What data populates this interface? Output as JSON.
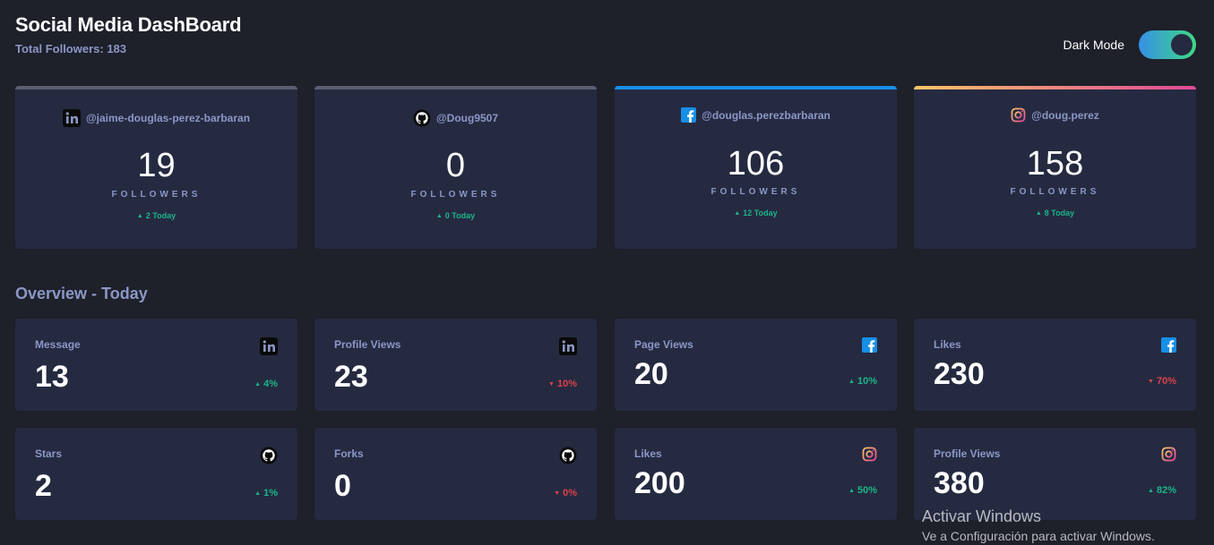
{
  "header": {
    "title": "Social Media DashBoard",
    "total_followers": "Total Followers: 183"
  },
  "toggle": {
    "label": "Dark Mode",
    "state": "on"
  },
  "colors": {
    "background": "#1e202a",
    "card": "#252a41",
    "muted_text": "#8b97c6",
    "up": "#1db489",
    "down": "#dc414c",
    "facebook": "#178fe6",
    "linkedin": "#0a0a0a",
    "github": "#0a0a0a",
    "instagram": "linear-gradient(90deg, #fdc468, #df4996)"
  },
  "cards": [
    {
      "icon": "linkedin-icon",
      "handle": "@jaime-douglas-perez-barbaran",
      "count": "19",
      "label": "FOLLOWERS",
      "today": "2 Today",
      "topbar": "#5b5f73"
    },
    {
      "icon": "github-icon",
      "handle": "@Doug9507",
      "count": "0",
      "label": "FOLLOWERS",
      "today": "0 Today",
      "topbar": "#5b5f73"
    },
    {
      "icon": "facebook-icon",
      "handle": "@douglas.perezbarbaran",
      "count": "106",
      "label": "FOLLOWERS",
      "today": "12 Today",
      "topbar": "#178fe6"
    },
    {
      "icon": "instagram-icon",
      "handle": "@doug.perez",
      "count": "158",
      "label": "FOLLOWERS",
      "today": "8 Today",
      "topbar": "linear-gradient(90deg, #fdc468, #df4996)"
    }
  ],
  "overview": {
    "title": "Overview - Today",
    "tiles": [
      {
        "label": "Message",
        "value": "13",
        "icon": "linkedin-icon",
        "change": "4%",
        "direction": "up"
      },
      {
        "label": "Profile Views",
        "value": "23",
        "icon": "linkedin-icon",
        "change": "10%",
        "direction": "down"
      },
      {
        "label": "Page Views",
        "value": "20",
        "icon": "facebook-icon",
        "change": "10%",
        "direction": "up"
      },
      {
        "label": "Likes",
        "value": "230",
        "icon": "facebook-icon",
        "change": "70%",
        "direction": "down"
      },
      {
        "label": "Stars",
        "value": "2",
        "icon": "github-icon",
        "change": "1%",
        "direction": "up"
      },
      {
        "label": "Forks",
        "value": "0",
        "icon": "github-icon",
        "change": "0%",
        "direction": "down"
      },
      {
        "label": "Likes",
        "value": "200",
        "icon": "instagram-icon",
        "change": "50%",
        "direction": "up"
      },
      {
        "label": "Profile Views",
        "value": "380",
        "icon": "instagram-icon",
        "change": "82%",
        "direction": "up"
      }
    ]
  },
  "watermark": {
    "line1": "Activar Windows",
    "line2": "Ve a Configuración para activar Windows."
  }
}
